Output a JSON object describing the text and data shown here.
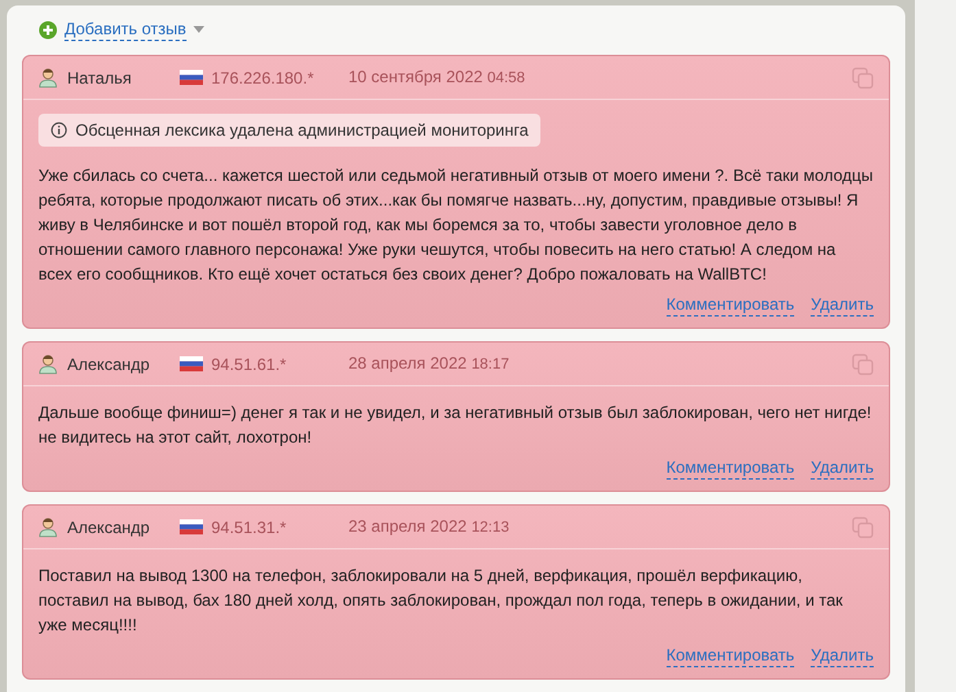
{
  "add_review": {
    "label": "Добавить отзыв"
  },
  "reviews": [
    {
      "author": "Наталья",
      "ip": "176.226.180.*",
      "date": "10 сентября 2022",
      "time": "04:58",
      "notice": "Обсценная лексика удалена администрацией мониторинга",
      "text": "Уже сбилась со счета... кажется шестой или седьмой негативный отзыв от моего имени ?. Всё таки молодцы ребята, которые продолжают писать об этих...как бы помягче назвать...ну, допустим, правдивые отзывы! Я живу в Челябинске и вот пошёл второй год, как мы боремся за то, чтобы завести уголовное дело в отношении самого главного персонажа! Уже руки чешутся, чтобы повесить на него статью! А следом на всех его сообщников. Кто ещё хочет остаться без своих денег? Добро пожаловать на WallBTC!",
      "actions": [
        "Комментировать",
        "Удалить"
      ]
    },
    {
      "author": "Александр",
      "ip": "94.51.61.*",
      "date": "28 апреля 2022",
      "time": "18:17",
      "text": "Дальше вообще финиш=) денег я так и не увидел, и за негативный отзыв был заблокирован, чего нет нигде! не видитесь на этот сайт, лохотрон!",
      "actions": [
        "Комментировать",
        "Удалить"
      ]
    },
    {
      "author": "Александр",
      "ip": "94.51.31.*",
      "date": "23 апреля 2022",
      "time": "12:13",
      "text": "Поставил на вывод 1300 на телефон, заблокировали на 5 дней, верфикация, прошёл верфикацию, поставил на вывод, бах 180 дней холд, опять заблокирован, прождал пол года, теперь в ожидании, и так уже месяц!!!!",
      "actions": [
        "Комментировать",
        "Удалить"
      ]
    }
  ]
}
